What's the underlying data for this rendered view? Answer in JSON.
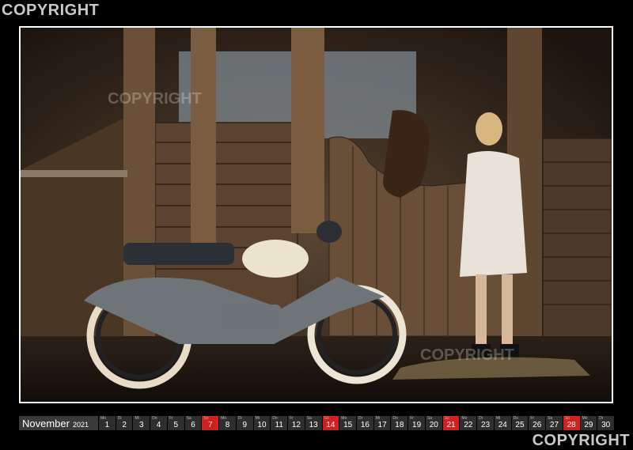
{
  "watermark": {
    "top": "COPYRIGHT",
    "bottom": "COPYRIGHT",
    "photo": "COPYRIGHT"
  },
  "colors": {
    "background": "#000000",
    "day_cell": "#2e2e2e",
    "sunday_cell": "#d21f1f",
    "month_cell": "#3a3a3a",
    "text": "#ffffff"
  },
  "calendar": {
    "month": "November",
    "year": "2021",
    "days": [
      {
        "dow": "Mo",
        "num": "1",
        "red": false
      },
      {
        "dow": "Di",
        "num": "2",
        "red": false
      },
      {
        "dow": "Mi",
        "num": "3",
        "red": false
      },
      {
        "dow": "Do",
        "num": "4",
        "red": false
      },
      {
        "dow": "Fr",
        "num": "5",
        "red": false
      },
      {
        "dow": "Sa",
        "num": "6",
        "red": false
      },
      {
        "dow": "So",
        "num": "7",
        "red": true
      },
      {
        "dow": "Mo",
        "num": "8",
        "red": false
      },
      {
        "dow": "Di",
        "num": "9",
        "red": false
      },
      {
        "dow": "Mi",
        "num": "10",
        "red": false
      },
      {
        "dow": "Do",
        "num": "11",
        "red": false
      },
      {
        "dow": "Fr",
        "num": "12",
        "red": false
      },
      {
        "dow": "Sa",
        "num": "13",
        "red": false
      },
      {
        "dow": "So",
        "num": "14",
        "red": true
      },
      {
        "dow": "Mo",
        "num": "15",
        "red": false
      },
      {
        "dow": "Di",
        "num": "16",
        "red": false
      },
      {
        "dow": "Mi",
        "num": "17",
        "red": false
      },
      {
        "dow": "Do",
        "num": "18",
        "red": false
      },
      {
        "dow": "Fr",
        "num": "19",
        "red": false
      },
      {
        "dow": "Sa",
        "num": "20",
        "red": false
      },
      {
        "dow": "So",
        "num": "21",
        "red": true
      },
      {
        "dow": "Mo",
        "num": "22",
        "red": false
      },
      {
        "dow": "Di",
        "num": "23",
        "red": false
      },
      {
        "dow": "Mi",
        "num": "24",
        "red": false
      },
      {
        "dow": "Do",
        "num": "25",
        "red": false
      },
      {
        "dow": "Fr",
        "num": "26",
        "red": false
      },
      {
        "dow": "Sa",
        "num": "27",
        "red": false
      },
      {
        "dow": "So",
        "num": "28",
        "red": true
      },
      {
        "dow": "Mo",
        "num": "29",
        "red": false
      },
      {
        "dow": "Di",
        "num": "30",
        "red": false
      }
    ]
  }
}
